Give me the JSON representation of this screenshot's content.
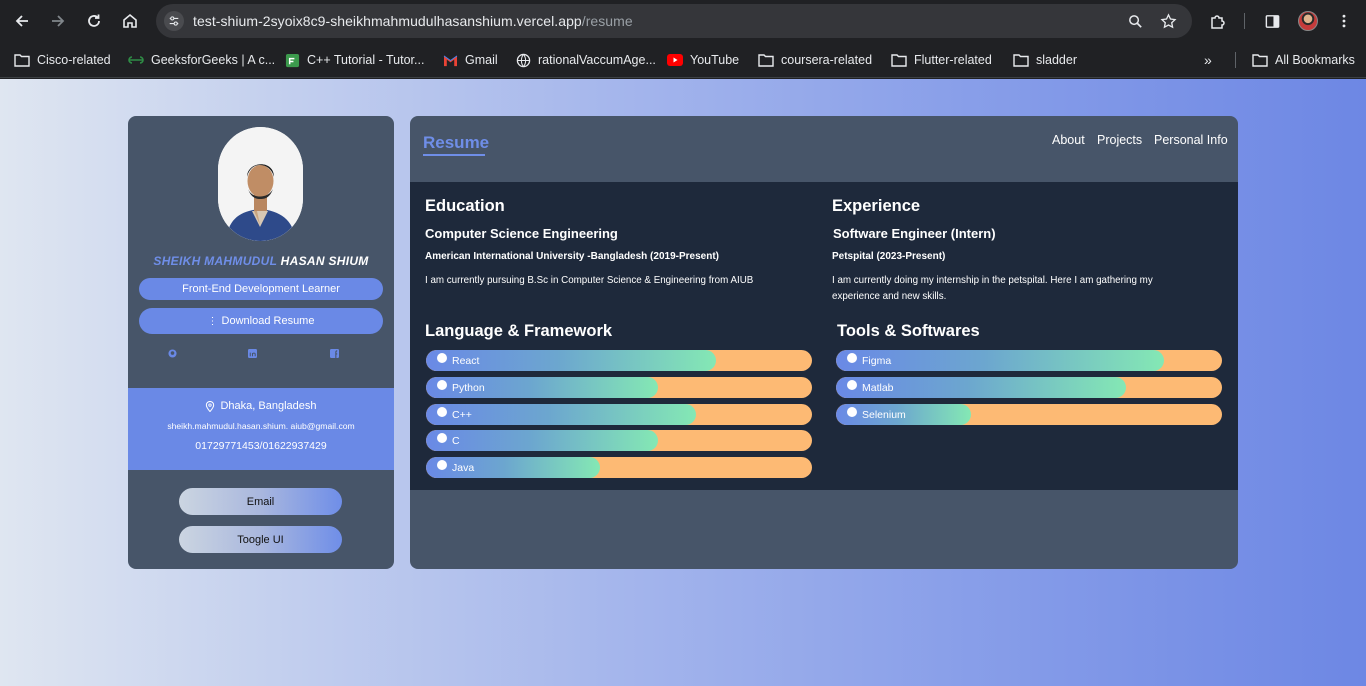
{
  "browser": {
    "url_host": "test-shium-2syoix8c9-sheikhmahmudulhasanshium.vercel.app",
    "url_path": "/resume",
    "bookmarks": [
      {
        "label": "Cisco-related",
        "icon": "folder-icon"
      },
      {
        "label": "GeeksforGeeks | A c...",
        "icon": "geeksforgeeks-icon"
      },
      {
        "label": "C++ Tutorial - Tutor...",
        "icon": "cpp-tutorial-icon"
      },
      {
        "label": "Gmail",
        "icon": "gmail-icon"
      },
      {
        "label": "rationalVaccumAge...",
        "icon": "globe-icon"
      },
      {
        "label": "YouTube",
        "icon": "youtube-icon"
      },
      {
        "label": "coursera-related",
        "icon": "folder-icon"
      },
      {
        "label": "Flutter-related",
        "icon": "folder-icon"
      },
      {
        "label": "sladder",
        "icon": "folder-icon"
      }
    ],
    "all_bookmarks": "All Bookmarks",
    "more": "»"
  },
  "colors": {
    "accent": "#6a89e6",
    "card": "#475569",
    "content_bg": "#1e293b",
    "bar_track": "#fdba74",
    "bar_fill_end": "#84e8b4"
  },
  "profile": {
    "name_first": "SHEIKH MAHMUDUL",
    "name_last": "HASAN SHIUM",
    "role": "Front-End Development Learner",
    "download": "Download Resume",
    "socials": [
      "github-icon",
      "linkedin-icon",
      "facebook-icon"
    ],
    "location": "Dhaka, Bangladesh",
    "email": "sheikh.mahmudul.hasan.shium. aiub@gmail.com",
    "phone": "01729771453/01622937429",
    "email_button": "Email",
    "toggle_button": "Toogle UI"
  },
  "header": {
    "title": "Resume",
    "nav": [
      "About",
      "Projects",
      "Personal Info"
    ]
  },
  "education": {
    "heading": "Education",
    "degree": "Computer Science Engineering",
    "institute": "American International University -Bangladesh (2019-Present)",
    "desc": "I am currently pursuing B.Sc in Computer Science & Engineering from AIUB"
  },
  "experience": {
    "heading": "Experience",
    "role": "Software Engineer (Intern)",
    "company": "Petspital (2023-Present)",
    "desc_line1": "I am currently doing my internship in the petspital. Here I am gathering my",
    "desc_line2": "experience and new skills."
  },
  "languages": {
    "heading": "Language & Framework",
    "items": [
      {
        "name": "React",
        "level": 0.75
      },
      {
        "name": "Python",
        "level": 0.6
      },
      {
        "name": "C++",
        "level": 0.7
      },
      {
        "name": "C",
        "level": 0.6
      },
      {
        "name": "Java",
        "level": 0.45
      }
    ]
  },
  "tools": {
    "heading": "Tools & Softwares",
    "items": [
      {
        "name": "Figma",
        "level": 0.85
      },
      {
        "name": "Matlab",
        "level": 0.75
      },
      {
        "name": "Selenium",
        "level": 0.35
      }
    ]
  }
}
